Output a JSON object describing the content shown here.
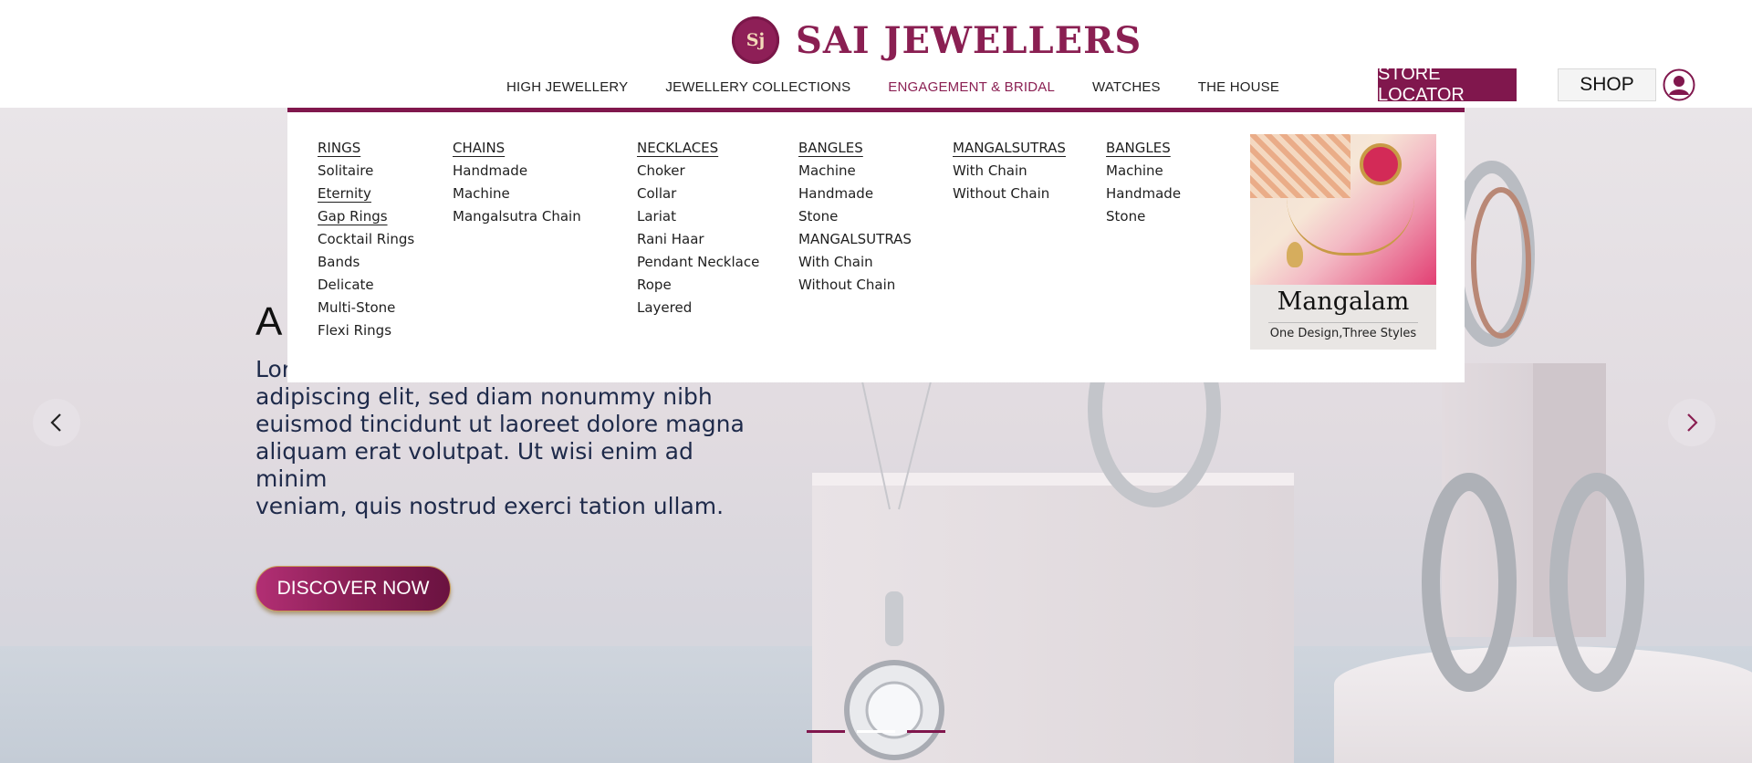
{
  "brand": {
    "name": "SAI JEWELLERS",
    "mark": "Sj"
  },
  "nav": {
    "items": [
      "HIGH JEWELLERY",
      "JEWELLERY COLLECTIONS",
      "ENGAGEMENT & BRIDAL",
      "WATCHES",
      "THE HOUSE"
    ],
    "active": "ENGAGEMENT & BRIDAL"
  },
  "actions": {
    "store_locator": "STORE LOCATOR",
    "shop": "SHOP",
    "user_icon": "user-circle-icon"
  },
  "menu": {
    "rings": {
      "heading": "RINGS",
      "items": [
        "Solitaire",
        "Eternity",
        "Gap Rings",
        "Cocktail Rings",
        "Bands",
        "Delicate",
        "Multi-Stone",
        "Flexi Rings"
      ]
    },
    "chains": {
      "heading": "CHAINS",
      "items": [
        "Handmade",
        "Machine",
        "Mangalsutra Chain"
      ]
    },
    "necklaces": {
      "heading": "NECKLACES",
      "items": [
        "Choker",
        "Collar",
        "Lariat",
        "Rani Haar",
        "Pendant Necklace",
        "Rope",
        "Layered"
      ]
    },
    "bangles": {
      "heading": "BANGLES",
      "items": [
        "Machine",
        "Handmade",
        "Stone",
        "MANGALSUTRAS",
        "With Chain",
        "Without Chain"
      ]
    },
    "mangalsutras": {
      "heading": "MANGALSUTRAS",
      "items": [
        "With Chain",
        "Without Chain"
      ]
    },
    "bangles2": {
      "heading": "BANGLES",
      "items": [
        "Machine",
        "Handmade",
        "Stone"
      ]
    },
    "promo": {
      "title": "Mangalam",
      "subtitle": "One Design,Three Styles"
    }
  },
  "hero": {
    "heading": "A",
    "text": "Lor adipiscing elit, sed diam nonummy nibh euismod tincidunt ut laoreet dolore magna aliquam erat volutpat. Ut wisi enim ad minim veniam, quis nostrud exerci tation ullam.",
    "text_lines": [
      "Lor",
      "adipiscing elit, sed diam nonummy nibh",
      "euismod tincidunt ut laoreet dolore magna",
      "aliquam erat volutpat. Ut wisi enim ad minim",
      "veniam, quis nostrud exerci tation ullam."
    ],
    "cta": "DISCOVER NOW",
    "prev_icon": "chevron-left-icon",
    "next_icon": "chevron-right-icon",
    "slides": 3,
    "active_slide": 1
  },
  "colors": {
    "brand": "#80174d",
    "brand_text": "#8a1f52"
  }
}
